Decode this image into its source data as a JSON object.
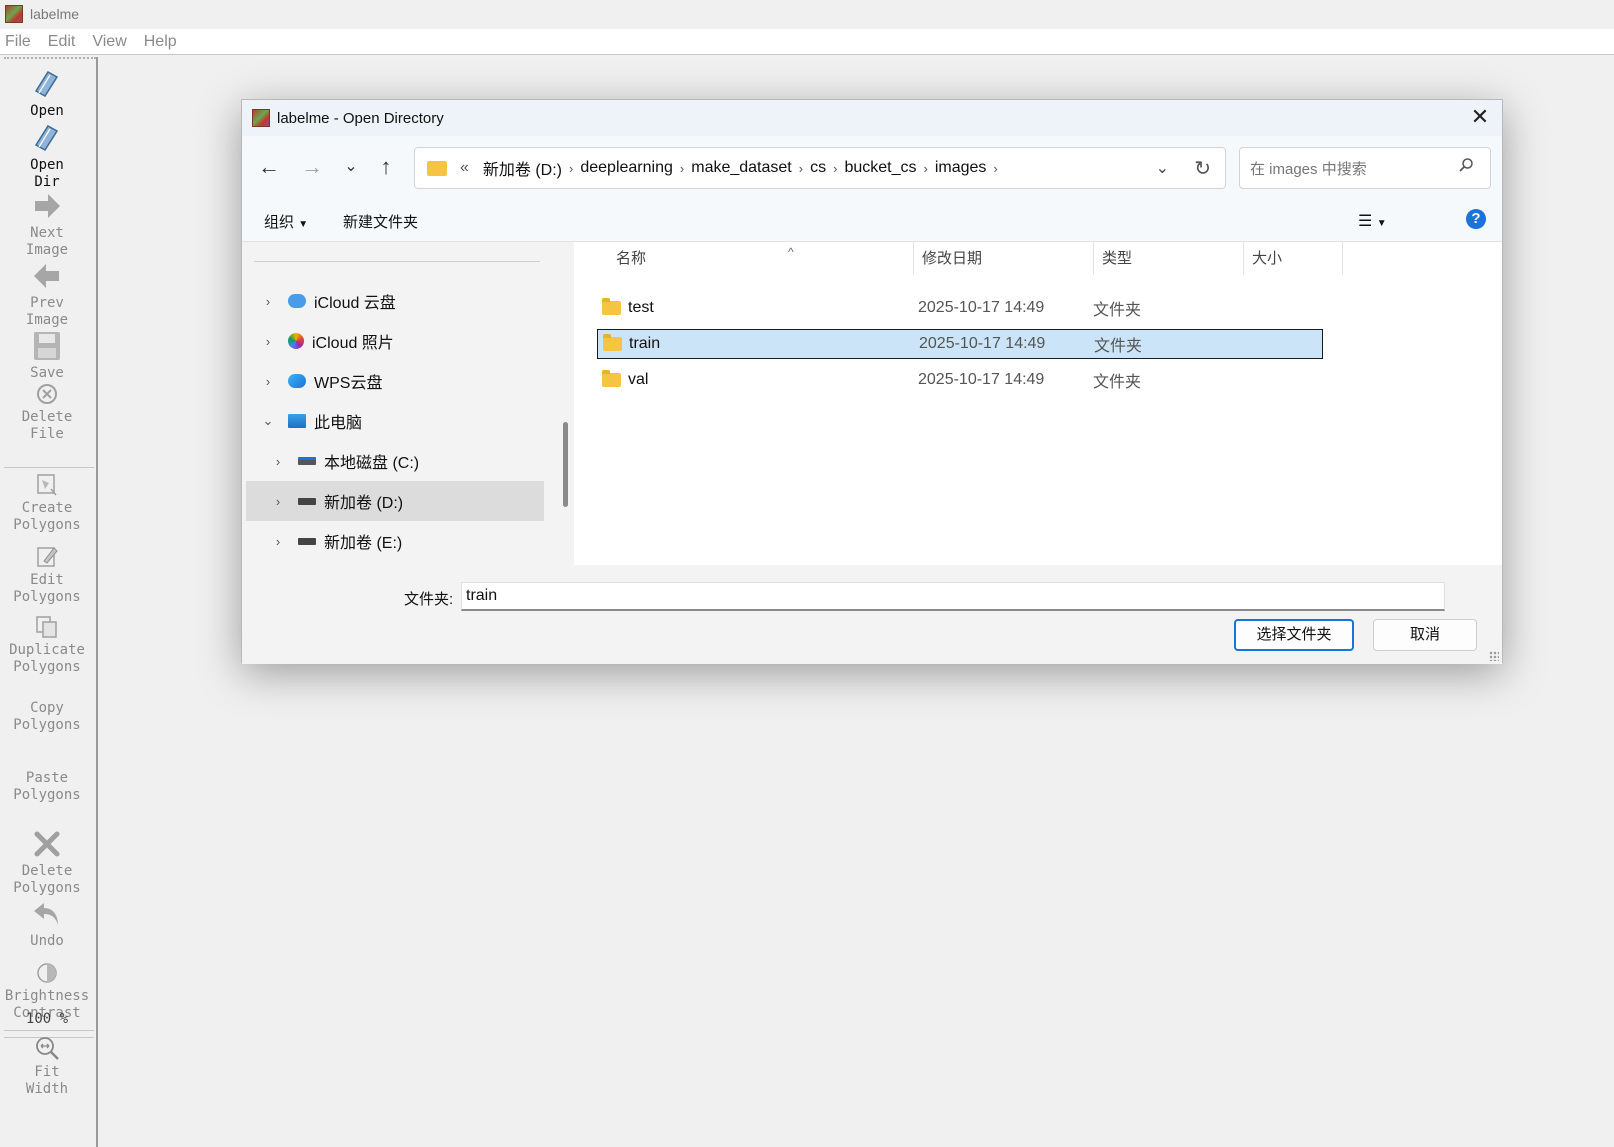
{
  "app": {
    "title": "labelme"
  },
  "menu": [
    "File",
    "Edit",
    "View",
    "Help"
  ],
  "toolbar": {
    "open": "Open",
    "open_dir": "Open\nDir",
    "next_image": "Next\nImage",
    "prev_image": "Prev\nImage",
    "save": "Save",
    "delete_file": "Delete\nFile",
    "create_polygons": "Create\nPolygons",
    "edit_polygons": "Edit\nPolygons",
    "duplicate_polygons": "Duplicate\nPolygons",
    "copy_polygons": "Copy\nPolygons",
    "paste_polygons": "Paste\nPolygons",
    "delete_polygons": "Delete\nPolygons",
    "undo": "Undo",
    "brightness_contrast": "Brightness\nContrast",
    "zoom": "100 %",
    "fit_width": "Fit\nWidth"
  },
  "dialog": {
    "title": "labelme - Open Directory",
    "breadcrumb_prefix": "«",
    "breadcrumb": [
      "新加卷 (D:)",
      "deeplearning",
      "make_dataset",
      "cs",
      "bucket_cs",
      "images"
    ],
    "search_placeholder": "在 images 中搜索",
    "organize": "组织",
    "new_folder": "新建文件夹",
    "nav_items": [
      {
        "label": "iCloud 云盘"
      },
      {
        "label": "iCloud 照片"
      },
      {
        "label": "WPS云盘"
      },
      {
        "label": "此电脑"
      },
      {
        "label": "本地磁盘 (C:)"
      },
      {
        "label": "新加卷 (D:)"
      },
      {
        "label": "新加卷 (E:)"
      }
    ],
    "columns": {
      "name": "名称",
      "modified": "修改日期",
      "type": "类型",
      "size": "大小"
    },
    "files": [
      {
        "name": "test",
        "modified": "2025-10-17 14:49",
        "type": "文件夹"
      },
      {
        "name": "train",
        "modified": "2025-10-17 14:49",
        "type": "文件夹"
      },
      {
        "name": "val",
        "modified": "2025-10-17 14:49",
        "type": "文件夹"
      }
    ],
    "folder_label": "文件夹:",
    "folder_value": "train",
    "select_button": "选择文件夹",
    "cancel_button": "取消"
  }
}
